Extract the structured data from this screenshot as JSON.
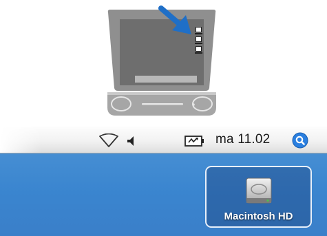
{
  "menubar": {
    "clock": "ma 11.02",
    "icons": [
      "wifi-icon",
      "volume-icon",
      "battery-icon",
      "spotlight-icon"
    ]
  },
  "desktop": {
    "drive_label": "Macintosh HD",
    "drive_icon": "hard-drive-icon"
  },
  "illustration": {
    "arrow_color": "#1f6fc7",
    "icons": [
      "imac-icon",
      "pointer-arrow-icon"
    ]
  },
  "colors": {
    "desktop_blue": "#3a85cf",
    "spotlight_blue": "#2a7fe0",
    "selection_border": "#e8f0fa"
  }
}
